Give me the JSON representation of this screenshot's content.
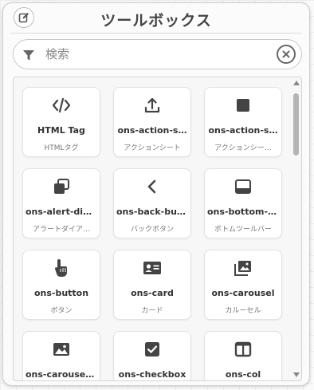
{
  "header": {
    "title": "ツールボックス",
    "edit_icon": "edit-square-icon"
  },
  "search": {
    "value": "",
    "placeholder": "検索",
    "filter_icon": "filter-icon",
    "clear_icon": "clear-circle-icon"
  },
  "items": [
    {
      "name": "HTML Tag",
      "sub": "HTMLタグ",
      "icon": "code-icon"
    },
    {
      "name": "ons-action-s…",
      "sub": "アクションシート",
      "icon": "upload-icon"
    },
    {
      "name": "ons-action-s…",
      "sub": "アクションシー…",
      "icon": "square-icon"
    },
    {
      "name": "ons-alert-dia…",
      "sub": "アラートダイア…",
      "icon": "stacked-cards-icon"
    },
    {
      "name": "ons-back-but…",
      "sub": "バックボタン",
      "icon": "chevron-left-icon"
    },
    {
      "name": "ons-bottom-t…",
      "sub": "ボトムツールバー",
      "icon": "bottom-toolbar-icon"
    },
    {
      "name": "ons-button",
      "sub": "ボタン",
      "icon": "touch-icon"
    },
    {
      "name": "ons-card",
      "sub": "カード",
      "icon": "id-card-icon"
    },
    {
      "name": "ons-carousel",
      "sub": "カルーセル",
      "icon": "photo-library-icon"
    },
    {
      "name": "ons-carousel…",
      "sub": "",
      "icon": "image-icon"
    },
    {
      "name": "ons-checkbox",
      "sub": "",
      "icon": "checkbox-icon"
    },
    {
      "name": "ons-col",
      "sub": "",
      "icon": "columns-icon"
    }
  ]
}
